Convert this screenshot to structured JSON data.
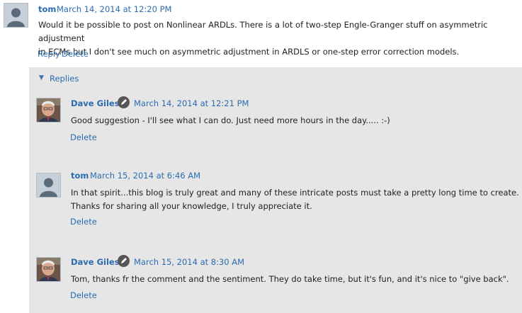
{
  "comment": {
    "author": "tom",
    "date": "March 14, 2014 at 12:20 PM",
    "text_line1": "Would it be possible to post on Nonlinear ARDLs. There is a lot of two-step Engle-Granger stuff on asymmetric adjustment",
    "text_line2": "in ECMs but I don't see much on asymmetric adjustment in ARDLS or one-step error correction models.",
    "reply_label": "Reply",
    "delete_label": "Delete"
  },
  "replies": {
    "toggle_label": "Replies",
    "items": [
      {
        "author": "Dave Giles",
        "date": "March 14, 2014 at 12:21 PM",
        "line1": "Good suggestion - I'll see what I can do. Just need more hours in the day..... :-)",
        "line2": "",
        "delete_label": "Delete",
        "avatar": "author-photo",
        "badge_icon": "pencil-icon"
      },
      {
        "author": "tom",
        "date": "March 15, 2014 at 6:46 AM",
        "line1": "In that spirit...this blog is truly great and many of these intricate posts must take a pretty long time to create.",
        "line2": "Thanks for sharing all your knowledge, I truly appreciate it.",
        "delete_label": "Delete",
        "avatar": "default-user-avatar"
      },
      {
        "author": "Dave Giles",
        "date": "March 15, 2014 at 8:30 AM",
        "line1": "Tom, thanks fr the comment and the sentiment. They do take time, but it's fun, and it's nice to \"give back\".",
        "line2": "",
        "delete_label": "Delete",
        "avatar": "author-photo",
        "badge_icon": "pencil-icon"
      }
    ]
  },
  "colors": {
    "link": "#2b6cb0",
    "replies_background": "#e6e6e6",
    "text": "#222222"
  }
}
